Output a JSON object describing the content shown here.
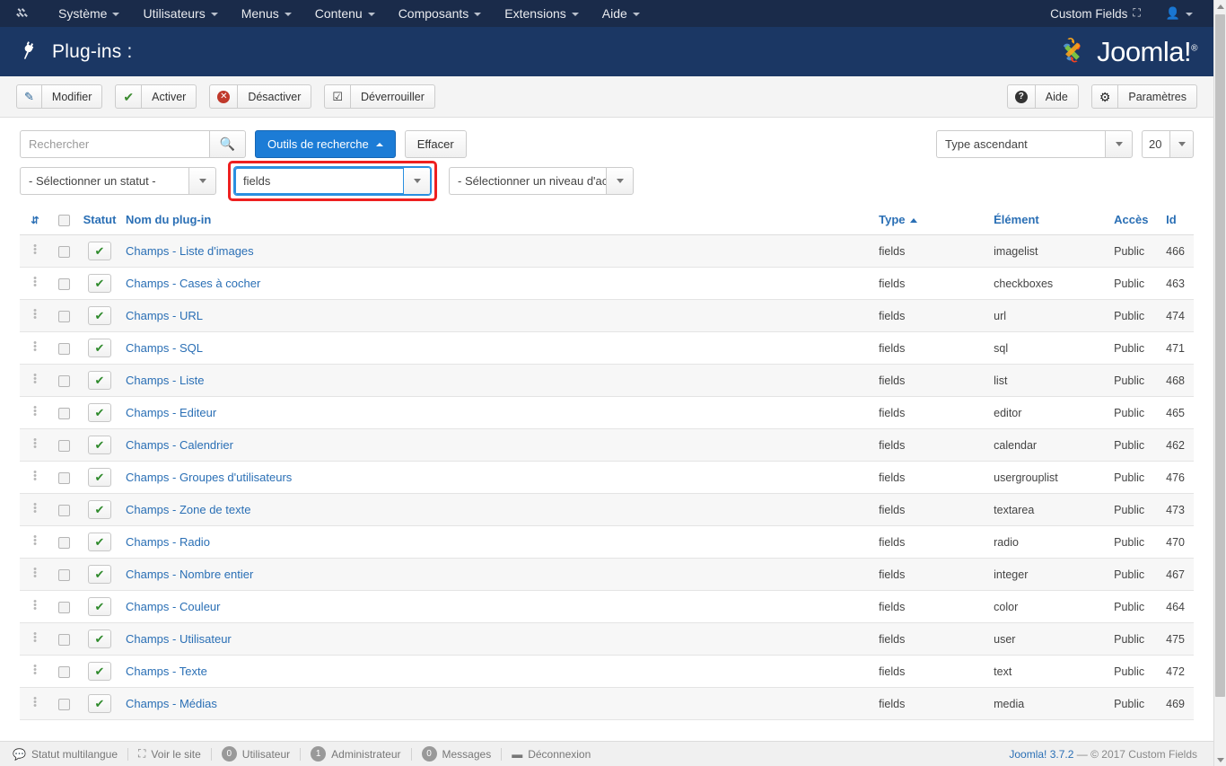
{
  "topbar": {
    "logo_icon": "joomla-mark-icon",
    "menu": [
      {
        "label": "Système",
        "caret": true
      },
      {
        "label": "Utilisateurs",
        "caret": true
      },
      {
        "label": "Menus",
        "caret": true
      },
      {
        "label": "Contenu",
        "caret": true
      },
      {
        "label": "Composants",
        "caret": true
      },
      {
        "label": "Extensions",
        "caret": true
      },
      {
        "label": "Aide",
        "caret": true
      }
    ],
    "site_label": "Custom Fields",
    "site_icon": "external-link-icon",
    "user_icon": "user-icon"
  },
  "header": {
    "icon": "plug-icon",
    "title": "Plug-ins :",
    "brand_text": "Joomla!",
    "brand_sup": "®"
  },
  "toolbar": {
    "left": [
      {
        "label": "Modifier",
        "icon": "edit-icon",
        "glyph": "✎"
      },
      {
        "label": "Activer",
        "icon": "check-icon",
        "glyph": "✔"
      },
      {
        "label": "Désactiver",
        "icon": "cancel-icon",
        "glyph": "✕"
      },
      {
        "label": "Déverrouiller",
        "icon": "checkbox-icon",
        "glyph": "☑"
      }
    ],
    "right": [
      {
        "label": "Aide",
        "icon": "help-icon",
        "glyph": "?"
      },
      {
        "label": "Paramètres",
        "icon": "gear-icon",
        "glyph": "⚙"
      }
    ]
  },
  "filters": {
    "search_placeholder": "Rechercher",
    "search_value": "",
    "search_icon": "search-icon",
    "search_tools_label": "Outils de recherche",
    "clear_label": "Effacer",
    "sort_value": "Type ascendant",
    "limit_value": "20",
    "status_value": "- Sélectionner un statut -",
    "folder_value": "fields",
    "access_value": "- Sélectionner un niveau d'accès -",
    "highlight_color": "#ee2020",
    "focus_color": "#2a8fe0"
  },
  "table": {
    "columns": {
      "ordering": "",
      "check_all": "",
      "status": "Statut",
      "name": "Nom du plug-in",
      "type": "Type",
      "element": "Élément",
      "access": "Accès",
      "id": "Id"
    },
    "sorted_column": "type",
    "sort_direction": "asc",
    "rows": [
      {
        "name": "Champs - Liste d'images",
        "type": "fields",
        "element": "imagelist",
        "access": "Public",
        "id": "466",
        "enabled": true
      },
      {
        "name": "Champs - Cases à cocher",
        "type": "fields",
        "element": "checkboxes",
        "access": "Public",
        "id": "463",
        "enabled": true
      },
      {
        "name": "Champs - URL",
        "type": "fields",
        "element": "url",
        "access": "Public",
        "id": "474",
        "enabled": true
      },
      {
        "name": "Champs - SQL",
        "type": "fields",
        "element": "sql",
        "access": "Public",
        "id": "471",
        "enabled": true
      },
      {
        "name": "Champs - Liste",
        "type": "fields",
        "element": "list",
        "access": "Public",
        "id": "468",
        "enabled": true
      },
      {
        "name": "Champs - Editeur",
        "type": "fields",
        "element": "editor",
        "access": "Public",
        "id": "465",
        "enabled": true
      },
      {
        "name": "Champs - Calendrier",
        "type": "fields",
        "element": "calendar",
        "access": "Public",
        "id": "462",
        "enabled": true
      },
      {
        "name": "Champs - Groupes d'utilisateurs",
        "type": "fields",
        "element": "usergrouplist",
        "access": "Public",
        "id": "476",
        "enabled": true
      },
      {
        "name": "Champs - Zone de texte",
        "type": "fields",
        "element": "textarea",
        "access": "Public",
        "id": "473",
        "enabled": true
      },
      {
        "name": "Champs - Radio",
        "type": "fields",
        "element": "radio",
        "access": "Public",
        "id": "470",
        "enabled": true
      },
      {
        "name": "Champs - Nombre entier",
        "type": "fields",
        "element": "integer",
        "access": "Public",
        "id": "467",
        "enabled": true
      },
      {
        "name": "Champs - Couleur",
        "type": "fields",
        "element": "color",
        "access": "Public",
        "id": "464",
        "enabled": true
      },
      {
        "name": "Champs - Utilisateur",
        "type": "fields",
        "element": "user",
        "access": "Public",
        "id": "475",
        "enabled": true
      },
      {
        "name": "Champs - Texte",
        "type": "fields",
        "element": "text",
        "access": "Public",
        "id": "472",
        "enabled": true
      },
      {
        "name": "Champs - Médias",
        "type": "fields",
        "element": "media",
        "access": "Public",
        "id": "469",
        "enabled": true
      }
    ]
  },
  "statusbar": {
    "items": [
      {
        "label": "Statut multilangue",
        "icon": "comment-icon",
        "glyph": "▬",
        "badge": null
      },
      {
        "label": "Voir le site",
        "icon": "external-link-icon",
        "glyph": "↗",
        "badge": null
      },
      {
        "label": "Utilisateur",
        "icon": "user-count-icon",
        "glyph": "",
        "badge": "0"
      },
      {
        "label": "Administrateur",
        "icon": "admin-count-icon",
        "glyph": "",
        "badge": "1"
      },
      {
        "label": "Messages",
        "icon": "message-count-icon",
        "glyph": "",
        "badge": "0"
      },
      {
        "label": "Déconnexion",
        "icon": "logout-icon",
        "glyph": "—",
        "badge": null
      }
    ],
    "version_link": "Joomla! 3.7.2",
    "copyright": "— © 2017 Custom Fields"
  }
}
